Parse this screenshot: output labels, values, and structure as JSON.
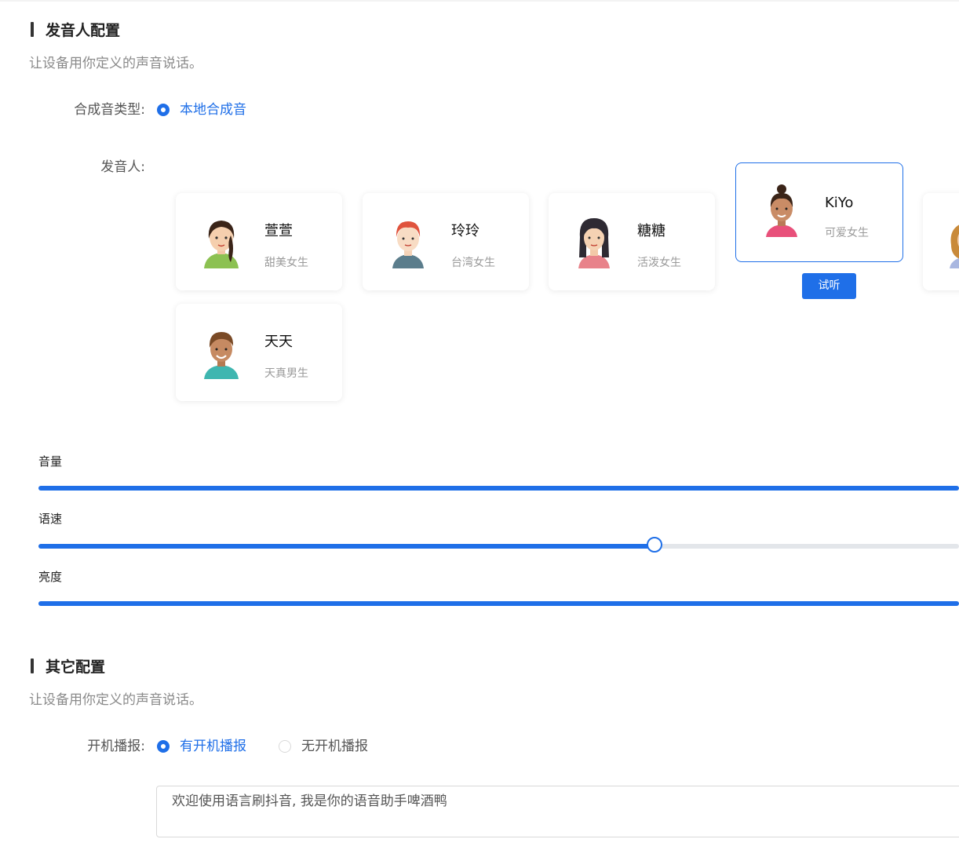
{
  "voice_section": {
    "title": "发音人配置",
    "description": "让设备用你定义的声音说话。",
    "synth_type_label": "合成音类型:",
    "synth_type_option": "本地合成音",
    "speaker_label": "发音人:",
    "speakers": [
      {
        "name": "萱萱",
        "desc": "甜美女生"
      },
      {
        "name": "玲玲",
        "desc": "台湾女生"
      },
      {
        "name": "糖糖",
        "desc": "活泼女生"
      },
      {
        "name": "KiYo",
        "desc": "可爱女生"
      },
      {
        "name": "天天",
        "desc": "天真男生"
      }
    ],
    "selected_speaker": "KiYo",
    "try_button": "试听"
  },
  "sliders": {
    "volume": {
      "label": "音量",
      "value_percent": 100
    },
    "speed": {
      "label": "语速",
      "value_percent": 67
    },
    "brightness": {
      "label": "亮度",
      "value_percent": 100
    }
  },
  "other_section": {
    "title": "其它配置",
    "description": "让设备用你定义的声音说话。",
    "boot_label": "开机播报:",
    "boot_option_on": "有开机播报",
    "boot_option_off": "无开机播报",
    "boot_selected": "有开机播报",
    "boot_text": "欢迎使用语言刷抖音, 我是你的语音助手啤酒鸭"
  },
  "colors": {
    "accent": "#1f6fe8",
    "track": "#e3e6ea"
  }
}
